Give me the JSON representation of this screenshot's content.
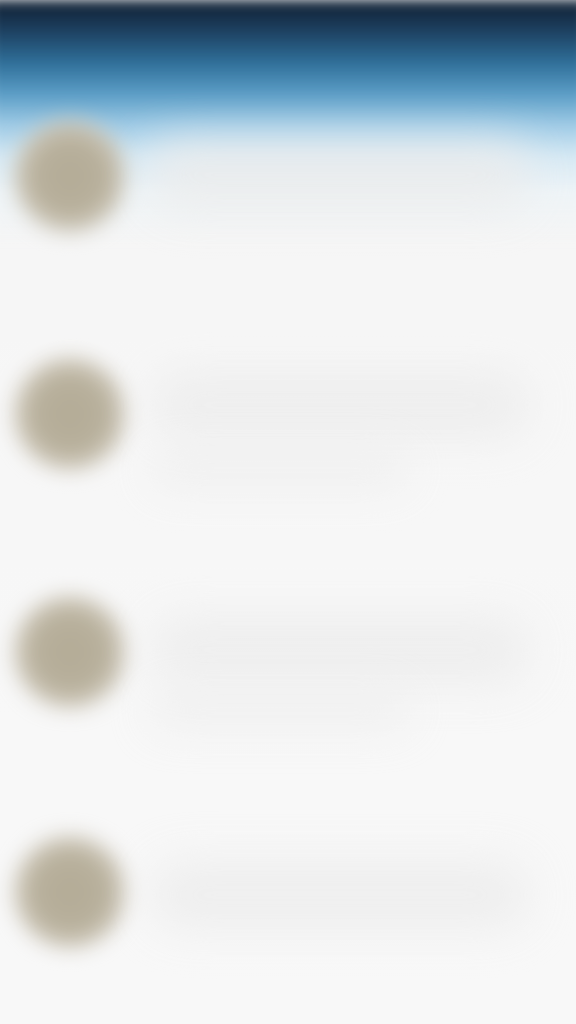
{
  "header": {
    "gradient_colors": [
      "#0f1e30",
      "#2f6f99",
      "#9fcbe6",
      "#eef4f7"
    ]
  },
  "list": {
    "items": [
      {
        "avatar": "avatar-placeholder-icon"
      },
      {
        "avatar": "avatar-placeholder-icon"
      },
      {
        "avatar": "avatar-placeholder-icon"
      },
      {
        "avatar": "avatar-placeholder-icon"
      }
    ]
  },
  "colors": {
    "background": "#f6f6f6",
    "avatar": "#b3ab96"
  }
}
